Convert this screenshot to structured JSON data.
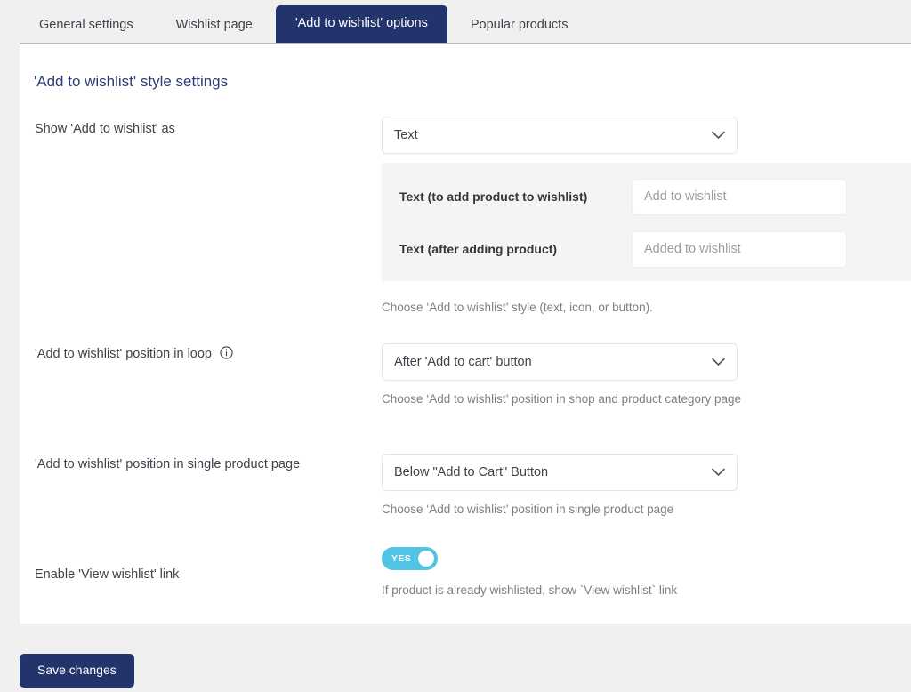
{
  "tabs": [
    {
      "label": "General settings",
      "active": false
    },
    {
      "label": "Wishlist page",
      "active": false
    },
    {
      "label": "'Add to wishlist' options",
      "active": true
    },
    {
      "label": "Popular products",
      "active": false
    }
  ],
  "card": {
    "title": "'Add to wishlist' style settings"
  },
  "rows": {
    "style": {
      "label": "Show 'Add to wishlist' as",
      "select_value": "Text",
      "helper": "Choose ‘Add to wishlist’ style (text, icon, or button).",
      "subpanel": [
        {
          "label": "Text (to add product to wishlist)",
          "value": "Add to wishlist"
        },
        {
          "label": "Text (after adding product)",
          "value": "Added to wishlist"
        }
      ]
    },
    "loop_position": {
      "label": "'Add to wishlist' position in loop",
      "has_info_icon": true,
      "select_value": "After 'Add to cart' button",
      "helper": "Choose ‘Add to wishlist’ position in shop and product category page"
    },
    "single_position": {
      "label": "'Add to wishlist' position in single product page",
      "select_value": "Below \"Add to Cart\" Button",
      "helper": "Choose ‘Add to wishlist’ position in single product page"
    },
    "view_link": {
      "label": "Enable 'View wishlist' link",
      "toggle_state": "YES",
      "toggle_on": true,
      "helper": "If product is already wishlisted, show `View wishlist` link"
    }
  },
  "footer": {
    "save_label": "Save changes"
  },
  "colors": {
    "brand_navy": "#23336b",
    "heading_navy": "#2c3e7a",
    "toggle_on": "#4fc4e4",
    "page_bg": "#f0f0f1",
    "panel_bg": "#f4f4f5"
  }
}
